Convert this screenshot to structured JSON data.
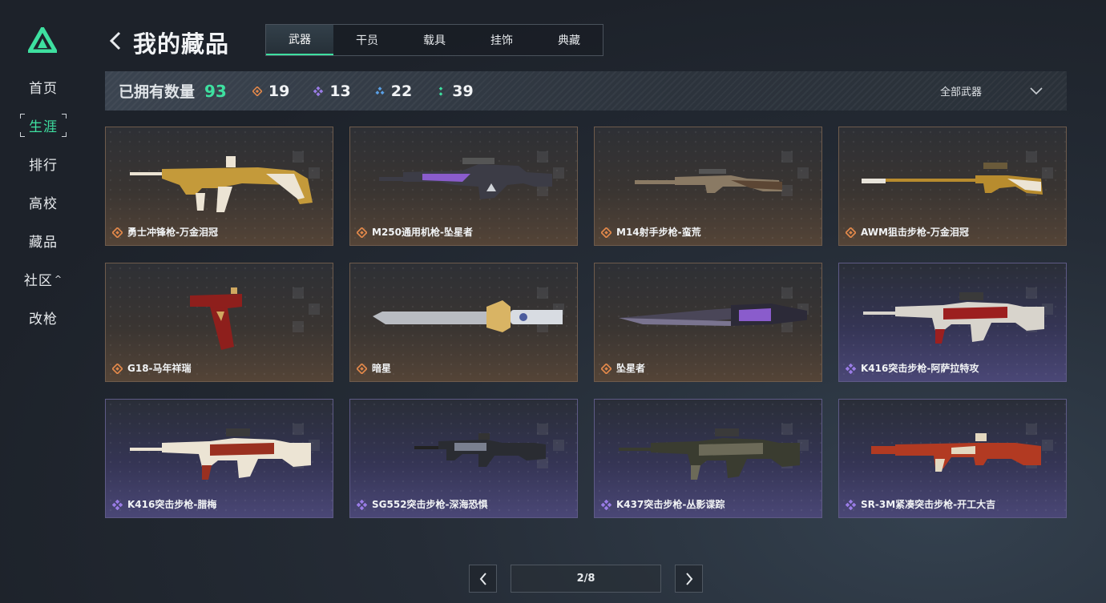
{
  "sidebar": {
    "items": [
      {
        "label": "首页",
        "active": false
      },
      {
        "label": "生涯",
        "active": true
      },
      {
        "label": "排行",
        "active": false
      },
      {
        "label": "高校",
        "active": false
      },
      {
        "label": "藏品",
        "active": false
      },
      {
        "label": "社区",
        "active": false,
        "has_caret": true
      },
      {
        "label": "改枪",
        "active": false
      }
    ],
    "caret": "^"
  },
  "header": {
    "title": "我的藏品",
    "tabs": [
      {
        "label": "武器",
        "active": true
      },
      {
        "label": "干员",
        "active": false
      },
      {
        "label": "载具",
        "active": false
      },
      {
        "label": "挂饰",
        "active": false
      },
      {
        "label": "典藏",
        "active": false
      }
    ]
  },
  "stats": {
    "owned_label": "已拥有数量",
    "owned_count": "93",
    "rarity_counts": [
      {
        "icon": "orange-diamond-icon",
        "color": "#e0874a",
        "value": "19"
      },
      {
        "icon": "purple-diamond-icon",
        "color": "#9a7ce6",
        "value": "13"
      },
      {
        "icon": "blue-triangle-icon",
        "color": "#5aa0e6",
        "value": "22"
      },
      {
        "icon": "green-dots-icon",
        "color": "#3ee0a0",
        "value": "39"
      }
    ],
    "filter_label": "全部武器"
  },
  "items": [
    {
      "name": "勇士冲锋枪-万金泪冠",
      "rarity": "orange",
      "weapon": "smg",
      "colors": [
        "#c49a3a",
        "#ece4d4"
      ]
    },
    {
      "name": "M250通用机枪-坠星者",
      "rarity": "orange",
      "weapon": "lmg",
      "colors": [
        "#3c3c46",
        "#8a5ccc"
      ]
    },
    {
      "name": "M14射手步枪-蛮荒",
      "rarity": "orange",
      "weapon": "dmr",
      "colors": [
        "#8a7a64",
        "#5c4634"
      ]
    },
    {
      "name": "AWM狙击步枪-万金泪冠",
      "rarity": "orange",
      "weapon": "sniper",
      "colors": [
        "#b88c2e",
        "#ece4d4"
      ]
    },
    {
      "name": "G18-马年祥瑞",
      "rarity": "orange",
      "weapon": "pistol",
      "colors": [
        "#8e1f1c",
        "#d0a860"
      ]
    },
    {
      "name": "暗星",
      "rarity": "orange",
      "weapon": "knife",
      "colors": [
        "#b9bcc2",
        "#d9b464"
      ]
    },
    {
      "name": "坠星者",
      "rarity": "orange",
      "weapon": "knife2",
      "colors": [
        "#2c2a38",
        "#8a5ccc"
      ]
    },
    {
      "name": "K416突击步枪-阿萨拉特攻",
      "rarity": "purple",
      "weapon": "rifle",
      "colors": [
        "#d8d4cc",
        "#9c1f1f"
      ]
    },
    {
      "name": "K416突击步枪-腊梅",
      "rarity": "purple",
      "weapon": "rifle",
      "colors": [
        "#ece4d4",
        "#9a3020"
      ]
    },
    {
      "name": "SG552突击步枪-深海恐惧",
      "rarity": "purple",
      "weapon": "rifle2",
      "colors": [
        "#2a2c32",
        "#7a8090"
      ]
    },
    {
      "name": "K437突击步枪-丛影谍踪",
      "rarity": "purple",
      "weapon": "rifle",
      "colors": [
        "#3a3c30",
        "#6c6a58"
      ]
    },
    {
      "name": "SR-3M紧凑突击步枪-开工大吉",
      "rarity": "purple",
      "weapon": "rifle3",
      "colors": [
        "#b23a22",
        "#e4d8c0"
      ]
    }
  ],
  "pagination": {
    "text": "2/8",
    "current": 2,
    "total": 8
  },
  "colors": {
    "accent": "#3ee0a0",
    "orange": "#e0874a",
    "purple": "#9a7ce6"
  }
}
